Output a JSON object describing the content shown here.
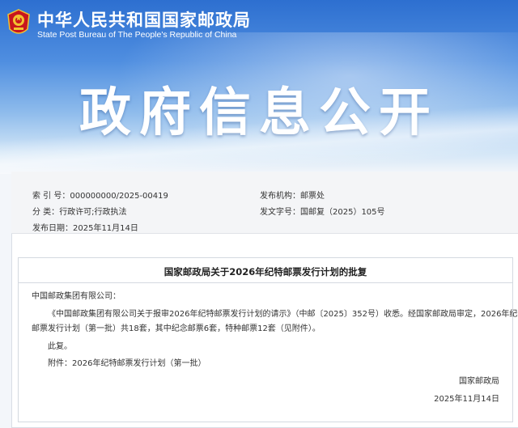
{
  "header": {
    "agency_cn": "中华人民共和国国家邮政局",
    "agency_en": "State Post Bureau of The People's Republic of China",
    "banner_title": "政府信息公开",
    "emblem_icon": "national-emblem"
  },
  "meta": {
    "index_label": "索 引 号：",
    "index_value": "000000000/2025-00419",
    "category_label": "分      类：",
    "category_value": "行政许可;行政执法",
    "date_label": "发布日期：",
    "date_value": "2025年11月14日",
    "publisher_label": "发布机构：",
    "publisher_value": "邮票处",
    "docno_label": "发文字号：",
    "docno_value": "国邮复（2025）105号"
  },
  "document": {
    "title": "国家邮政局关于2026年纪特邮票发行计划的批复",
    "salutation": "中国邮政集团有限公司：",
    "body_line1": "《中国邮政集团有限公司关于报审2026年纪特邮票发行计划的请示》（中邮〔2025〕352号）收悉。经国家邮政局审定，2026年纪特",
    "body_line2": "邮票发行计划（第一批）共18套，其中纪念邮票6套，特种邮票12套（见附件）。",
    "reply": "此复。",
    "attachment": "附件：2026年纪特邮票发行计划（第一批）",
    "signature": "国家邮政局",
    "date": "2025年11月14日"
  },
  "colors": {
    "banner_top": "#2d6fd0",
    "banner_bottom": "#d3e6f7",
    "emblem_red": "#c8161d",
    "emblem_gold": "#f2c230"
  }
}
